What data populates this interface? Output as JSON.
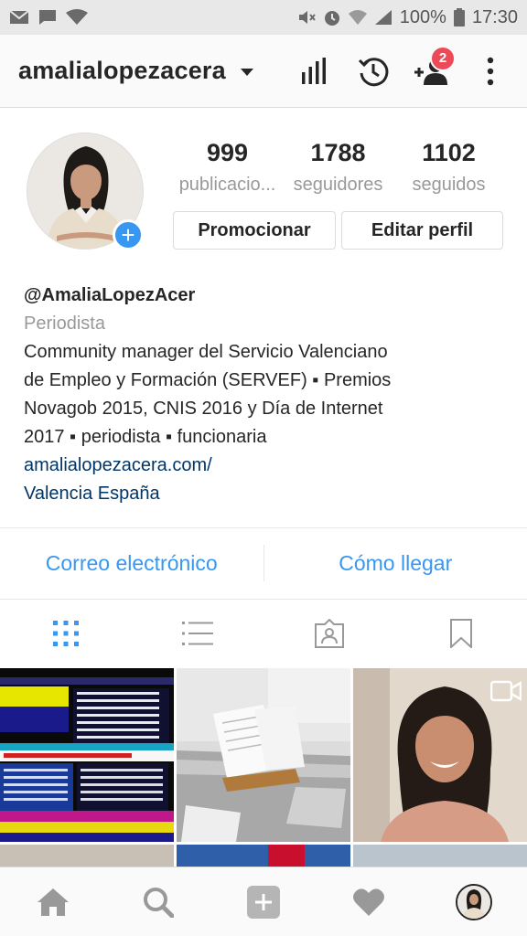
{
  "status_bar": {
    "battery": "100%",
    "time": "17:30"
  },
  "header": {
    "username": "amalialopezacera",
    "notification_count": "2"
  },
  "profile": {
    "stats": [
      {
        "value": "999",
        "label": "publicacio..."
      },
      {
        "value": "1788",
        "label": "seguidores"
      },
      {
        "value": "1102",
        "label": "seguidos"
      }
    ],
    "promote_label": "Promocionar",
    "edit_label": "Editar perfil"
  },
  "bio": {
    "handle": "@AmaliaLopezAcer",
    "category": "Periodista",
    "lines": [
      "Community manager del Servicio Valenciano",
      "de Empleo y Formación (SERVEF) ▪ Premios",
      "Novagob 2015, CNIS 2016 y Día de Internet",
      "2017 ▪ periodista ▪ funcionaria"
    ],
    "website": "amalialopezacera.com/",
    "location": "Valencia España"
  },
  "contact": {
    "email_label": "Correo electrónico",
    "directions_label": "Cómo llegar"
  },
  "tabs": [
    "grid-icon",
    "list-icon",
    "tagged-icon",
    "saved-icon"
  ],
  "grid_posts": [
    {
      "kind": "tv-teletext-screen"
    },
    {
      "kind": "desk-with-papers"
    },
    {
      "kind": "selfie-video"
    }
  ],
  "bottom_nav": [
    "home-icon",
    "search-icon",
    "add-icon",
    "heart-icon",
    "profile-avatar"
  ],
  "colors": {
    "accent_blue": "#3897f0",
    "link_dark_blue": "#003569",
    "badge_red": "#ed4956",
    "muted_text": "#999999"
  }
}
